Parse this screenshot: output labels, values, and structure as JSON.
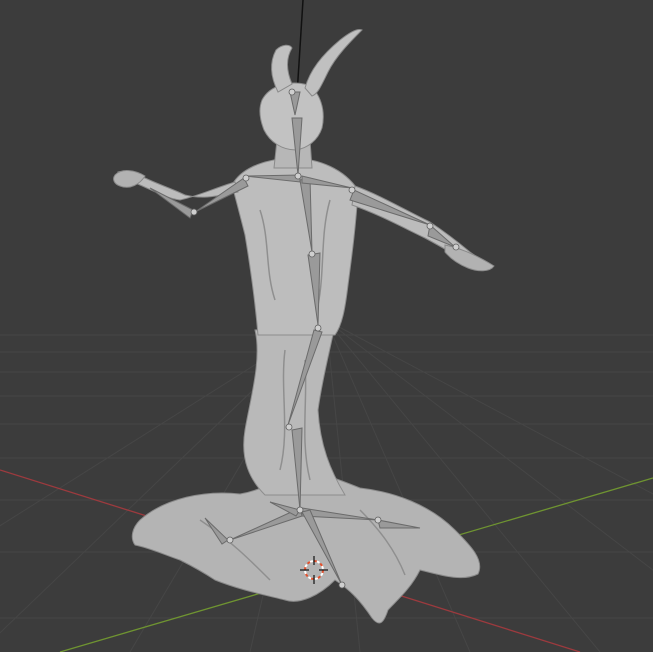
{
  "viewport": {
    "background_color": "#3c3c3c",
    "grid_color": "#464646",
    "x_axis_color": "#9c3a3e",
    "y_axis_color": "#6f9431",
    "mesh_color": "#b8b8b8",
    "mesh_shadow_color": "#6e6e6e",
    "armature_color": "#9a9a9a",
    "armature_dark_color": "#6b6b6b",
    "cursor_primary_color": "#e2512e",
    "cursor_secondary_color": "#ffffff"
  },
  "icons": {
    "cursor": "3d-cursor-icon"
  }
}
